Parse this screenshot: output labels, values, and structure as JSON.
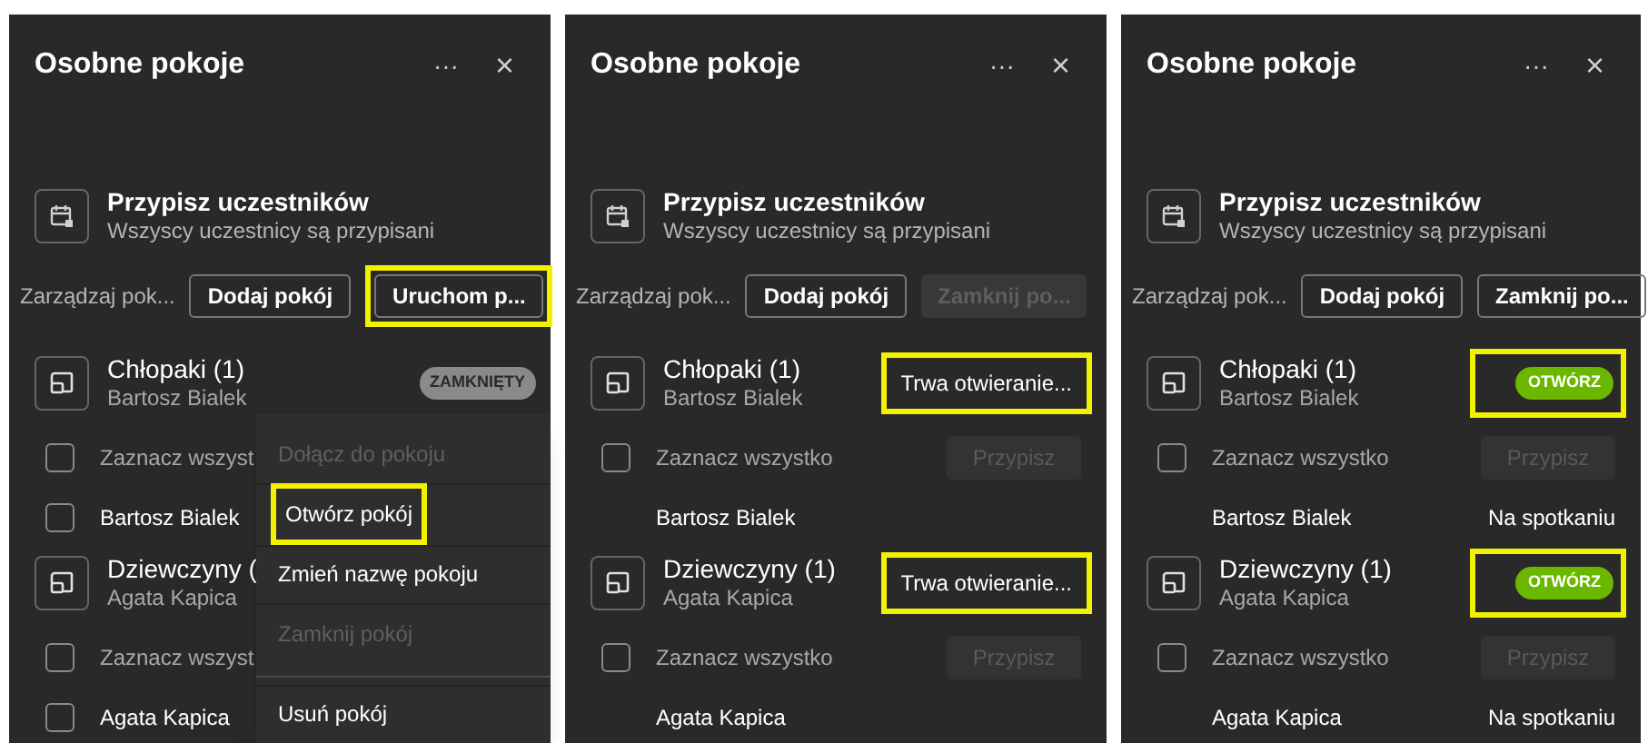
{
  "panels": [
    {
      "title": "Osobne pokoje",
      "more_label": "···",
      "close_label": "×",
      "assign": {
        "title": "Przypisz uczestników",
        "subtitle": "Wszyscy uczestnicy są przypisani"
      },
      "manage": {
        "label": "Zarządzaj pok...",
        "buttons": [
          {
            "label": "Dodaj pokój",
            "disabled": false,
            "highlighted": false
          },
          {
            "label": "Uruchom p...",
            "disabled": false,
            "highlighted": true
          }
        ]
      },
      "rooms": [
        {
          "name": "Chłopaki (1)",
          "summary": "Bartosz Bialek",
          "status": {
            "kind": "closed-badge",
            "label": "ZAMKNIĘTY",
            "highlighted": false
          },
          "select_all": {
            "label": "Zaznacz wszyst",
            "checked": false
          },
          "participants": [
            {
              "name": "Bartosz Bialek",
              "kind": "selectable",
              "checked": false
            }
          ]
        },
        {
          "name": "Dziewczyny (",
          "summary": "Agata Kapica",
          "select_all": {
            "label": "Zaznacz wszyst",
            "checked": false
          },
          "participants": [
            {
              "name": "Agata Kapica",
              "kind": "selectable",
              "checked": false
            }
          ]
        }
      ],
      "menu": {
        "items": [
          {
            "label": "Dołącz do pokoju",
            "disabled": true,
            "highlighted": false,
            "divider_after": false
          },
          {
            "label": "Otwórz pokój",
            "disabled": false,
            "highlighted": true,
            "divider_after": false
          },
          {
            "label": "Zmień nazwę pokoju",
            "disabled": false,
            "highlighted": false,
            "divider_after": false
          },
          {
            "label": "Zamknij pokój",
            "disabled": true,
            "highlighted": false,
            "divider_after": true
          },
          {
            "label": "Usuń pokój",
            "disabled": false,
            "highlighted": false,
            "divider_after": false
          }
        ]
      }
    },
    {
      "title": "Osobne pokoje",
      "more_label": "···",
      "close_label": "×",
      "assign": {
        "title": "Przypisz uczestników",
        "subtitle": "Wszyscy uczestnicy są przypisani"
      },
      "manage": {
        "label": "Zarządzaj pok...",
        "buttons": [
          {
            "label": "Dodaj pokój",
            "disabled": false,
            "highlighted": false
          },
          {
            "label": "Zamknij po...",
            "disabled": true,
            "highlighted": false
          }
        ]
      },
      "rooms": [
        {
          "name": "Chłopaki (1)",
          "summary": "Bartosz Bialek",
          "status": {
            "kind": "text",
            "label": "Trwa otwieranie...",
            "highlighted": true
          },
          "select_all": {
            "label": "Zaznacz wszystko",
            "checked": false,
            "assign_button": {
              "label": "Przypisz",
              "disabled": true
            }
          },
          "participants": [
            {
              "name": "Bartosz Bialek",
              "kind": "plain"
            }
          ]
        },
        {
          "name": "Dziewczyny (1)",
          "summary": "Agata Kapica",
          "status": {
            "kind": "text",
            "label": "Trwa otwieranie...",
            "highlighted": true
          },
          "select_all": {
            "label": "Zaznacz wszystko",
            "checked": false,
            "assign_button": {
              "label": "Przypisz",
              "disabled": true
            }
          },
          "participants": [
            {
              "name": "Agata Kapica",
              "kind": "plain"
            }
          ]
        }
      ]
    },
    {
      "title": "Osobne pokoje",
      "more_label": "···",
      "close_label": "×",
      "assign": {
        "title": "Przypisz uczestników",
        "subtitle": "Wszyscy uczestnicy są przypisani"
      },
      "manage": {
        "label": "Zarządzaj pok...",
        "buttons": [
          {
            "label": "Dodaj pokój",
            "disabled": false,
            "highlighted": false
          },
          {
            "label": "Zamknij po...",
            "disabled": false,
            "highlighted": false
          }
        ]
      },
      "rooms": [
        {
          "name": "Chłopaki (1)",
          "summary": "Bartosz Bialek",
          "status": {
            "kind": "open-badge",
            "label": "OTWÓRZ",
            "highlighted": true
          },
          "select_all": {
            "label": "Zaznacz wszystko",
            "checked": false,
            "assign_button": {
              "label": "Przypisz",
              "disabled": true
            }
          },
          "participants": [
            {
              "name": "Bartosz Bialek",
              "kind": "plain",
              "presence": "Na spotkaniu"
            }
          ]
        },
        {
          "name": "Dziewczyny (1)",
          "summary": "Agata Kapica",
          "status": {
            "kind": "open-badge",
            "label": "OTWÓRZ",
            "highlighted": true
          },
          "select_all": {
            "label": "Zaznacz wszystko",
            "checked": false,
            "assign_button": {
              "label": "Przypisz",
              "disabled": true
            }
          },
          "participants": [
            {
              "name": "Agata Kapica",
              "kind": "plain",
              "presence": "Na spotkaniu"
            }
          ]
        }
      ]
    }
  ]
}
